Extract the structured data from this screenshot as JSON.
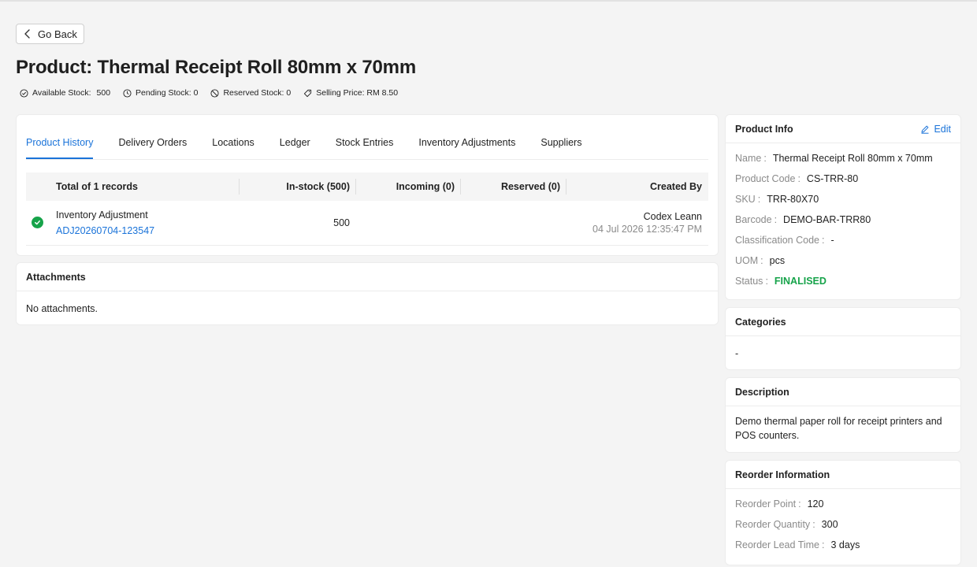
{
  "back_button": {
    "label": "Go Back"
  },
  "page_title": "Product: Thermal Receipt Roll 80mm x 70mm",
  "stats": {
    "available_label": "Available Stock:",
    "available_value": "500",
    "pending": "Pending Stock: 0",
    "reserved": "Reserved Stock: 0",
    "price": "Selling Price: RM 8.50"
  },
  "tabs": [
    "Product History",
    "Delivery Orders",
    "Locations",
    "Ledger",
    "Stock Entries",
    "Inventory Adjustments",
    "Suppliers"
  ],
  "history_table": {
    "headers": {
      "total": "Total of 1 records",
      "in_stock": "In-stock (500)",
      "incoming": "Incoming (0)",
      "reserved": "Reserved (0)",
      "created_by": "Created By"
    },
    "rows": [
      {
        "type": "Inventory Adjustment",
        "reference": "ADJ20260704-123547",
        "in_stock": "500",
        "created_by": "Codex Leann",
        "created_at": "04 Jul 2026 12:35:47 PM"
      }
    ]
  },
  "attachments": {
    "title": "Attachments",
    "empty_text": "No attachments."
  },
  "product_info": {
    "title": "Product Info",
    "edit_label": "Edit",
    "fields": [
      {
        "label": "Name",
        "value": "Thermal Receipt Roll 80mm x 70mm"
      },
      {
        "label": "Product Code",
        "value": "CS-TRR-80"
      },
      {
        "label": "SKU",
        "value": "TRR-80X70"
      },
      {
        "label": "Barcode",
        "value": "DEMO-BAR-TRR80"
      },
      {
        "label": "Classification Code",
        "value": "-"
      },
      {
        "label": "UOM",
        "value": "pcs"
      },
      {
        "label": "Status",
        "value": "FINALISED"
      }
    ]
  },
  "categories": {
    "title": "Categories",
    "value": "-"
  },
  "description": {
    "title": "Description",
    "text": "Demo thermal paper roll for receipt printers and POS counters."
  },
  "reorder": {
    "title": "Reorder Information",
    "fields": [
      {
        "label": "Reorder Point",
        "value": "120"
      },
      {
        "label": "Reorder Quantity",
        "value": "300"
      },
      {
        "label": "Reorder Lead Time",
        "value": "3 days"
      }
    ]
  },
  "colors": {
    "accent": "#1a73d9",
    "success": "#16a34a",
    "muted": "#8a8a8a"
  }
}
